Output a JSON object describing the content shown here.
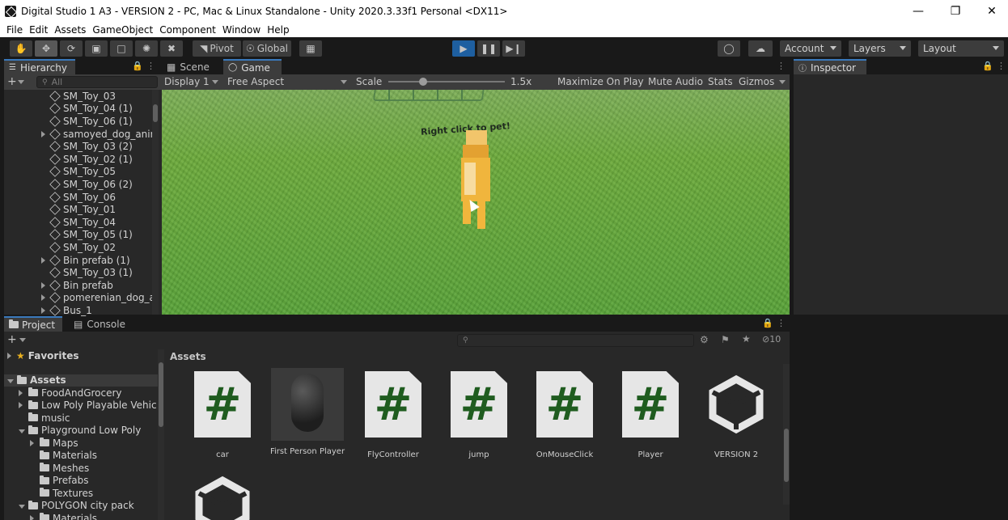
{
  "window": {
    "title": "Digital Studio 1 A3 - VERSION 2 - PC, Mac & Linux Standalone - Unity 2020.3.33f1 Personal <DX11>"
  },
  "menu": [
    "File",
    "Edit",
    "Assets",
    "GameObject",
    "Component",
    "Window",
    "Help"
  ],
  "toolbar": {
    "pivot": "Pivot",
    "global": "Global",
    "account": "Account",
    "layers": "Layers",
    "layout": "Layout"
  },
  "hierarchy": {
    "tab": "Hierarchy",
    "search_placeholder": "All",
    "items": [
      {
        "label": "SM_Toy_03",
        "expandable": false
      },
      {
        "label": "SM_Toy_04 (1)",
        "expandable": false
      },
      {
        "label": "SM_Toy_06 (1)",
        "expandable": false
      },
      {
        "label": "samoyed_dog_anir",
        "expandable": true
      },
      {
        "label": "SM_Toy_03 (2)",
        "expandable": false
      },
      {
        "label": "SM_Toy_02 (1)",
        "expandable": false
      },
      {
        "label": "SM_Toy_05",
        "expandable": false
      },
      {
        "label": "SM_Toy_06 (2)",
        "expandable": false
      },
      {
        "label": "SM_Toy_06",
        "expandable": false
      },
      {
        "label": "SM_Toy_01",
        "expandable": false
      },
      {
        "label": "SM_Toy_04",
        "expandable": false
      },
      {
        "label": "SM_Toy_05 (1)",
        "expandable": false
      },
      {
        "label": "SM_Toy_02",
        "expandable": false
      },
      {
        "label": "Bin prefab (1)",
        "expandable": true
      },
      {
        "label": "SM_Toy_03 (1)",
        "expandable": false
      },
      {
        "label": "Bin prefab",
        "expandable": true
      },
      {
        "label": "pomerenian_dog_a",
        "expandable": true
      },
      {
        "label": "Bus_1",
        "expandable": true
      }
    ]
  },
  "scene_tabs": {
    "scene": "Scene",
    "game": "Game"
  },
  "game_bar": {
    "display": "Display 1",
    "aspect": "Free Aspect",
    "scale_label": "Scale",
    "scale_value": "1.5x",
    "scale_fraction": 0.25,
    "maximize": "Maximize On Play",
    "mute": "Mute Audio",
    "stats": "Stats",
    "gizmos": "Gizmos"
  },
  "game_view": {
    "hint": "Right click to pet!"
  },
  "inspector": {
    "tab": "Inspector"
  },
  "bottom_tabs": {
    "project": "Project",
    "console": "Console"
  },
  "project": {
    "hidden_count": "10",
    "favorites": "Favorites",
    "tree": [
      {
        "label": "Assets",
        "depth": 0,
        "state": "open",
        "bold": true
      },
      {
        "label": "FoodAndGrocery",
        "depth": 1,
        "state": "closed"
      },
      {
        "label": "Low Poly Playable Vehic",
        "depth": 1,
        "state": "closed"
      },
      {
        "label": "music",
        "depth": 1,
        "state": "none"
      },
      {
        "label": "Playground Low Poly",
        "depth": 1,
        "state": "open"
      },
      {
        "label": "Maps",
        "depth": 2,
        "state": "closed"
      },
      {
        "label": "Materials",
        "depth": 2,
        "state": "none"
      },
      {
        "label": "Meshes",
        "depth": 2,
        "state": "none"
      },
      {
        "label": "Prefabs",
        "depth": 2,
        "state": "none"
      },
      {
        "label": "Textures",
        "depth": 2,
        "state": "none"
      },
      {
        "label": "POLYGON city pack",
        "depth": 1,
        "state": "open"
      },
      {
        "label": "Materials",
        "depth": 2,
        "state": "closed"
      }
    ],
    "breadcrumb": "Assets",
    "assets": [
      {
        "label": "car",
        "kind": "script"
      },
      {
        "label": "First Person Player",
        "kind": "prefab"
      },
      {
        "label": "FlyController",
        "kind": "script"
      },
      {
        "label": "jump",
        "kind": "script"
      },
      {
        "label": "OnMouseClick",
        "kind": "script"
      },
      {
        "label": "Player",
        "kind": "script"
      },
      {
        "label": "VERSION 2",
        "kind": "unity-scene"
      },
      {
        "label": "",
        "kind": "unity-scene"
      }
    ]
  },
  "colors": {
    "accent": "#3a79bb",
    "play_active": "#1e5fa0",
    "panel_bg": "#282828",
    "script_green": "#1f5c1f",
    "grass": "#6eaa3e"
  }
}
